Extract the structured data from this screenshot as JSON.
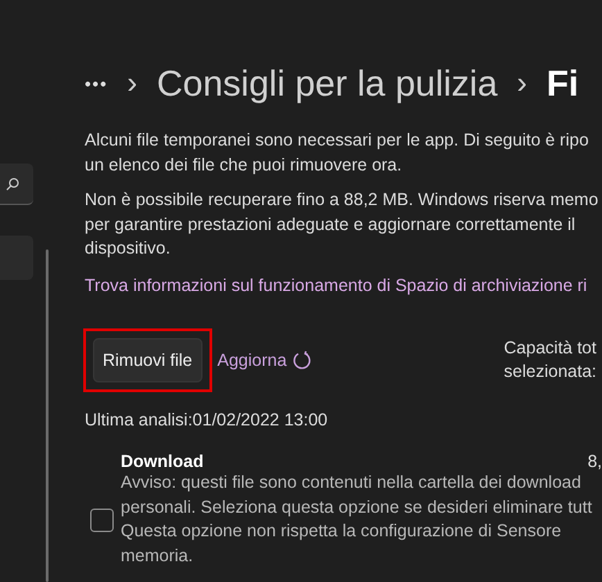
{
  "breadcrumb": {
    "more": "•••",
    "separator": "›",
    "items": [
      "Consigli per la pulizia",
      "Fi"
    ]
  },
  "intro": [
    "Alcuni file temporanei sono necessari per le app. Di seguito è ripo",
    "un elenco dei file che puoi rimuovere ora."
  ],
  "notice": [
    "Non è possibile recuperare fino a 88,2 MB. Windows riserva memo",
    "per garantire prestazioni adeguate e aggiornare correttamente il",
    "dispositivo."
  ],
  "info_link": "Trova informazioni sul funzionamento di Spazio di archiviazione ri",
  "actions": {
    "remove_button": {
      "label": "Rimuovi file",
      "highlighted": true
    },
    "refresh_link": "Aggiorna"
  },
  "selected_total": [
    "Capacità tot",
    "selezionata:"
  ],
  "last_scan": "Ultima analisi:01/02/2022 13:00",
  "categories": [
    {
      "name": "Download",
      "size": "8,",
      "checked": false,
      "description": [
        "Avviso: questi file sono contenuti nella cartella dei download",
        "personali. Seleziona questa opzione se desideri eliminare tutt",
        "Questa opzione non rispetta la configurazione di Sensore",
        "memoria."
      ]
    }
  ]
}
